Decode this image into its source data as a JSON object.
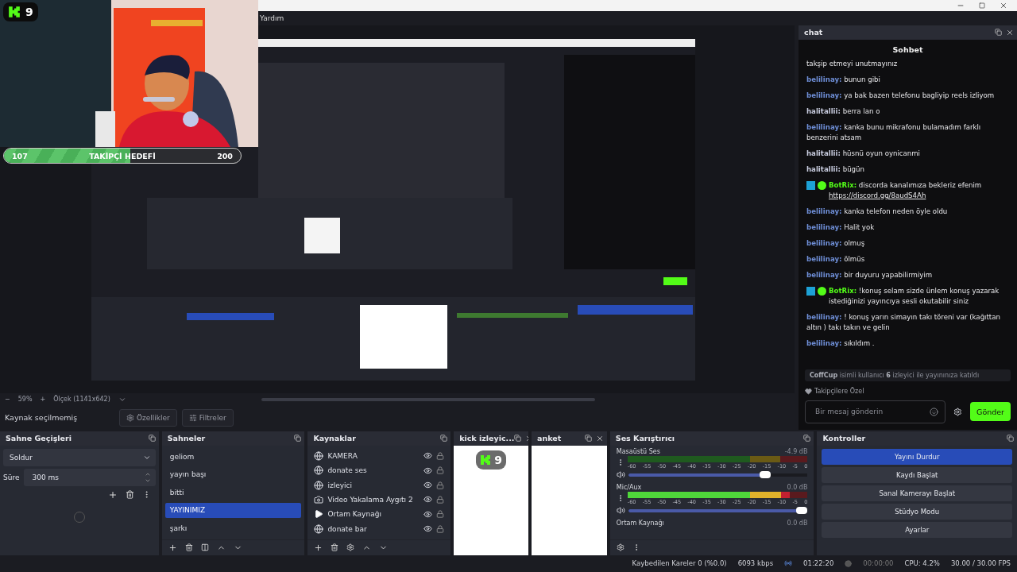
{
  "menu": [
    "Yardım"
  ],
  "overlay": {
    "badge": "9",
    "goal": {
      "current": "107",
      "label": "TAKİPÇİ HEDEFİ",
      "target": "200",
      "level": 0.535
    }
  },
  "preview": {
    "kind": "picture"
  },
  "zoom_bar": {
    "minus": "−",
    "zoom": "59%",
    "plus": "+",
    "scale": "Ölçek (1141x642)"
  },
  "source_bar": {
    "status": "Kaynak seçilmemiş",
    "buttons": [
      "Özellikler",
      "Filtreler"
    ]
  },
  "chat": {
    "dock_title": "chat",
    "title": "Sohbet",
    "messages": [
      {
        "kind": "text",
        "text": "takşip etmeyi unutmayınız"
      },
      {
        "kind": "user",
        "user": "belilinay",
        "sep": ":",
        "color": "#6f8fd8",
        "text": "bunun gibi"
      },
      {
        "kind": "user",
        "user": "belilinay",
        "sep": ":",
        "color": "#6f8fd8",
        "text": "ya bak bazen telefonu bagliyip reels izliyom"
      },
      {
        "kind": "user",
        "user": "halitallii",
        "sep": ":",
        "color": "#c9cde0",
        "text": "berra lan o"
      },
      {
        "kind": "user",
        "user": "belilinay",
        "sep": ":",
        "color": "#6f8fd8",
        "text": "kanka bunu mikrafonu bulamadım farklı benzerini atsam"
      },
      {
        "kind": "user",
        "user": "halitallii",
        "sep": ":",
        "color": "#c9cde0",
        "text": "hüsnü oyun oynicanmi"
      },
      {
        "kind": "user",
        "user": "halitallii",
        "sep": ":",
        "color": "#c9cde0",
        "text": "bügün"
      },
      {
        "kind": "bot",
        "user": "BotRix",
        "sep": ":",
        "color": "#53fc18",
        "text": "discorda kanalımıza bekleriz efenim",
        "link": "https://discord.gg/8audS4Ah"
      },
      {
        "kind": "user",
        "user": "belilinay",
        "sep": ":",
        "color": "#6f8fd8",
        "text": "kanka telefon neden öyle oldu"
      },
      {
        "kind": "user",
        "user": "belilinay",
        "sep": ":",
        "color": "#6f8fd8",
        "text": "Halit yok"
      },
      {
        "kind": "user",
        "user": "belilinay",
        "sep": ":",
        "color": "#6f8fd8",
        "text": "olmuş"
      },
      {
        "kind": "user",
        "user": "belilinay",
        "sep": ":",
        "color": "#6f8fd8",
        "text": "ölmüs"
      },
      {
        "kind": "user",
        "user": "belilinay",
        "sep": ":",
        "color": "#6f8fd8",
        "text": "bir duyuru yapabilirmiyim"
      },
      {
        "kind": "bot",
        "user": "BotRix",
        "sep": ":",
        "color": "#53fc18",
        "text": "!konuş selam sizde ünlem konuş yazarak istediğinizi yayıncıya sesli okutabilir siniz"
      },
      {
        "kind": "user",
        "user": "belilinay",
        "sep": ":",
        "color": "#6f8fd8",
        "text": "! konuş yarın simayın takı töreni var (kağıttan altın ) takı takın ve gelin"
      },
      {
        "kind": "user",
        "user": "belilinay",
        "sep": ":",
        "color": "#6f8fd8",
        "text": "sıkıldım ."
      }
    ],
    "notice": "**CoffCup** isimli kullanıcı **6** izleyici ile yayınınıza katıldı",
    "followers_only": "Takipçilere Özel",
    "input": {
      "placeholder": "Bir mesaj gönderin"
    },
    "send": "Gönder"
  },
  "transitions": {
    "title": "Sahne Geçişleri",
    "type": "Soldur",
    "duration_label": "Süre",
    "duration": "300 ms"
  },
  "scenes": {
    "title": "Sahneler",
    "items": [
      {
        "label": "geliom",
        "selected": false
      },
      {
        "label": "yayın başı",
        "selected": false
      },
      {
        "label": "bitti",
        "selected": false
      },
      {
        "label": "YAYINIMIZ",
        "selected": true
      },
      {
        "label": "şarkı",
        "selected": false
      }
    ]
  },
  "sources": {
    "title": "Kaynaklar",
    "items": [
      {
        "kind": "browser",
        "label": "KAMERA"
      },
      {
        "kind": "browser",
        "label": "donate ses"
      },
      {
        "kind": "browser",
        "label": "izleyici"
      },
      {
        "kind": "camera",
        "label": "Video Yakalama Aygıtı 2"
      },
      {
        "kind": "media",
        "label": "Ortam Kaynağı"
      },
      {
        "kind": "browser",
        "label": "donate bar"
      }
    ]
  },
  "kick_dock": {
    "title": "kick izleyic...",
    "badge": "9"
  },
  "poll_dock": {
    "title": "anket"
  },
  "mixer": {
    "title": "Ses Karıştırıcı",
    "channels": [
      {
        "name": "Masaüstü Ses",
        "reading": "-4.9 dB",
        "level": 0.78,
        "ticks": [
          "-60",
          "-55",
          "-50",
          "-45",
          "-40",
          "-35",
          "-30",
          "-25",
          "-20",
          "-15",
          "-10",
          "-5",
          "0"
        ]
      },
      {
        "name": "Mic/Aux",
        "reading": "0.0 dB",
        "meter": {
          "level": 0.9
        },
        "level": 1.0,
        "ticks": [
          "-60",
          "-55",
          "-50",
          "-45",
          "-40",
          "-35",
          "-30",
          "-25",
          "-20",
          "-15",
          "-10",
          "-5",
          "0"
        ]
      },
      {
        "name": "Ortam Kaynağı",
        "reading": "0.0 dB"
      }
    ]
  },
  "controls": {
    "title": "Kontroller",
    "buttons": [
      {
        "label": "Yayını Durdur",
        "active": true
      },
      {
        "label": "Kaydı Başlat",
        "active": false
      },
      {
        "label": "Sanal Kamerayı Başlat",
        "active": false
      },
      {
        "label": "Stüdyo Modu",
        "active": false
      },
      {
        "label": "Ayarlar",
        "active": false
      }
    ]
  },
  "status_bar": {
    "dropped": "Kaybedilen Kareler 0 (%0.0)",
    "bitrate": "6093 kbps",
    "stream_time": "01:22:20",
    "rec_time": "00:00:00",
    "cpu": "CPU: 4.2%",
    "fps": "30.00 / 30.00 FPS"
  }
}
